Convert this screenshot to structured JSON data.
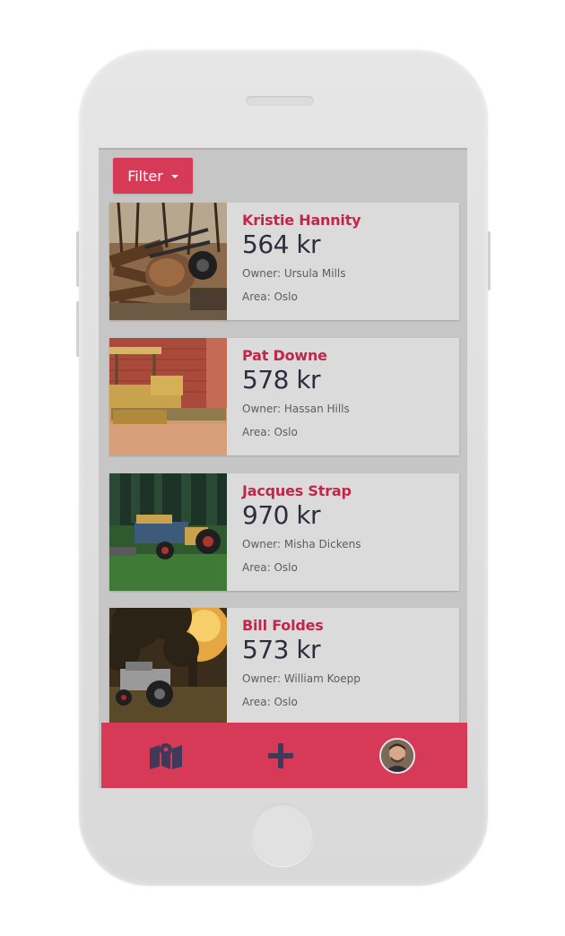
{
  "toolbar": {
    "filter_label": "Filter"
  },
  "listings": [
    {
      "name": "Kristie Hannity",
      "price": "564 kr",
      "owner": "Owner: Ursula Mills",
      "area": "Area: Oslo",
      "image": "wheelbarrow-scrap-photo"
    },
    {
      "name": "Pat Downe",
      "price": "578 kr",
      "owner": "Owner: Hassan Hills",
      "area": "Area: Oslo",
      "image": "bulldozer-photo"
    },
    {
      "name": "Jacques Strap",
      "price": "970 kr",
      "owner": "Owner: Misha Dickens",
      "area": "Area: Oslo",
      "image": "tractor-grass-photo"
    },
    {
      "name": "Bill Foldes",
      "price": "573 kr",
      "owner": "Owner: William Koepp",
      "area": "Area: Oslo",
      "image": "tractor-under-tree-photo"
    }
  ],
  "bottom_nav": {
    "items": [
      {
        "icon": "map-icon"
      },
      {
        "icon": "plus-icon"
      },
      {
        "icon": "avatar"
      }
    ]
  },
  "colors": {
    "accent": "#d63a56",
    "name_text": "#c0274a",
    "price_text": "#2b2e3e",
    "nav_icon": "#3f3a5a"
  }
}
